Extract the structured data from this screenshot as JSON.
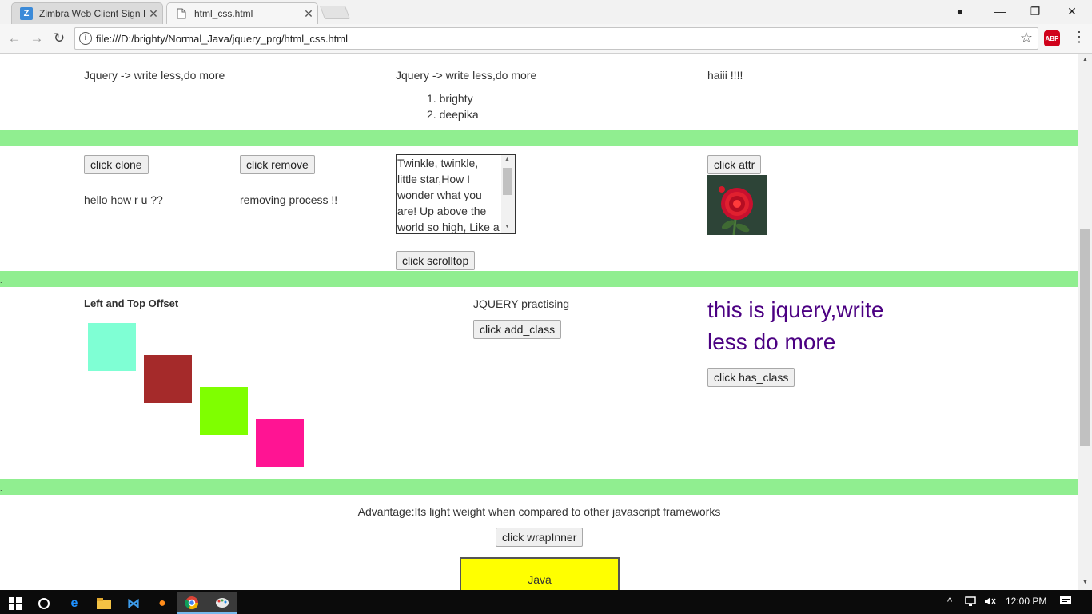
{
  "tabs": [
    {
      "title": "Zimbra Web Client Sign I",
      "icon": "zimbra-icon",
      "close": "✕"
    },
    {
      "title": "html_css.html",
      "icon": "page-icon",
      "close": "✕"
    }
  ],
  "window_controls": {
    "minimize": "—",
    "maximize": "❐",
    "close": "✕",
    "account": "●"
  },
  "toolbar": {
    "back": "←",
    "forward": "→",
    "reload": "↻",
    "url": "file:///D:/brighty/Normal_Java/jquery_prg/html_css.html",
    "star": "☆",
    "abp": "ABP",
    "menu": "⋮"
  },
  "section1": {
    "col1_text": "Jquery -> write less,do more",
    "col2_text": "Jquery -> write less,do more",
    "list": [
      "1. brighty",
      "2. deepika"
    ],
    "col3_text": "haiii !!!!"
  },
  "section2": {
    "clone_button": "click clone",
    "clone_text": "hello how r u ??",
    "remove_button": "click remove",
    "remove_text": "removing process !!",
    "textarea_text": "Twinkle, twinkle, little star,How I wonder what you are! Up above the world so high, Like a diamond in the sky.",
    "scrolltop_button": "click scrolltop",
    "attr_button": "click attr"
  },
  "section3": {
    "offset_title": "Left and Top Offset",
    "squares": [
      {
        "name": "aquamarine-square",
        "color": "#7fffd4"
      },
      {
        "name": "brown-square",
        "color": "#a52a2a"
      },
      {
        "name": "chartreuse-square",
        "color": "#7fff00"
      },
      {
        "name": "pink-square",
        "color": "#ff1493"
      }
    ],
    "practise_text": "JQUERY practising",
    "add_class_button": "click add_class",
    "big_text": "this is jquery,write less do more",
    "has_class_button": "click has_class"
  },
  "section4": {
    "advantage_text": "Advantage:Its light weight when compared to other javascript frameworks",
    "wrapinner_button": "click wrapInner",
    "java_text": "Java"
  },
  "band_marker": ".",
  "colors": {
    "band": "#90ee90",
    "java_box": "#ffff00",
    "purple_text": "#4b0082"
  },
  "taskbar": {
    "clock": "12:00 PM"
  }
}
